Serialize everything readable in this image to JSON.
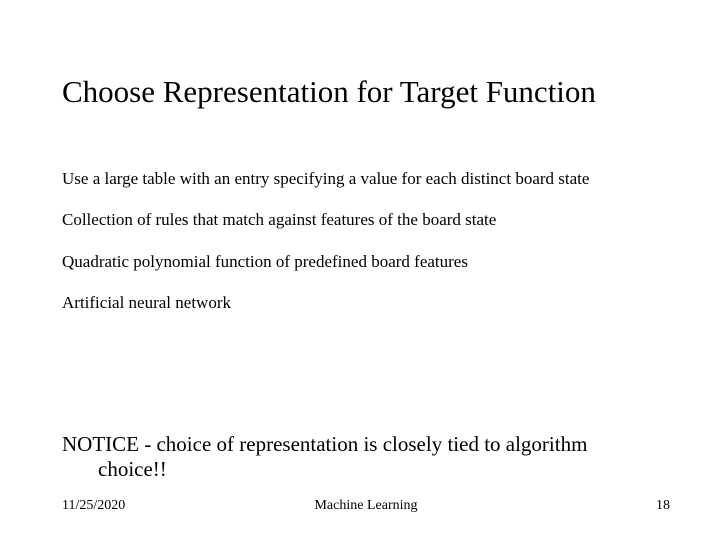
{
  "title": "Choose Representation for Target Function",
  "bullets": {
    "b0": "Use a large table with an entry specifying a value for each distinct board state",
    "b1": "Collection of rules that match against features of the board state",
    "b2": "Quadratic polynomial function of predefined board features",
    "b3": "Artificial neural network"
  },
  "notice": "NOTICE - choice of representation is closely tied to algorithm choice!!",
  "footer": {
    "date": "11/25/2020",
    "center": "Machine Learning",
    "page": "18"
  }
}
